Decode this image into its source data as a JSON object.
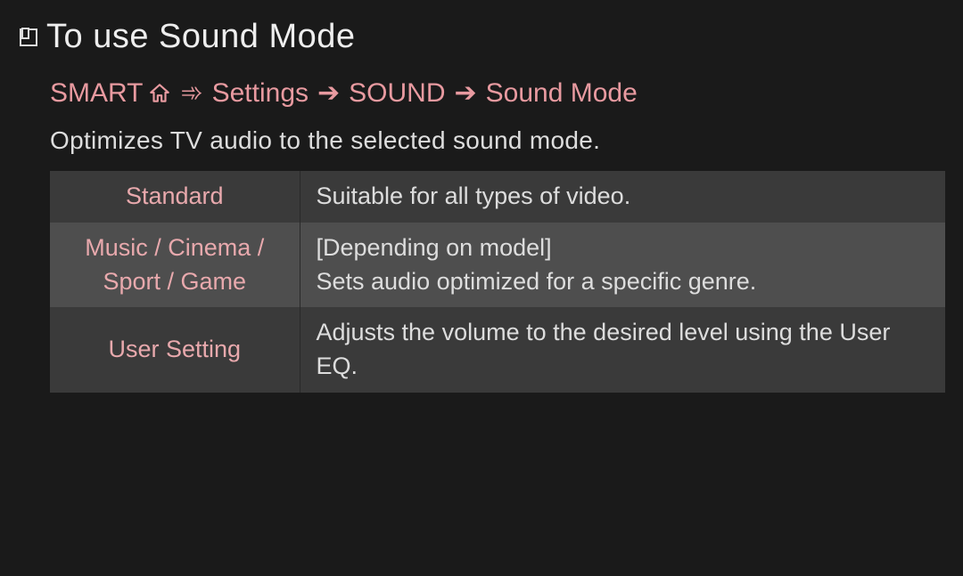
{
  "title": "To use Sound Mode",
  "breadcrumb": {
    "smart": "SMART",
    "settings": "Settings",
    "sound": "SOUND",
    "sound_mode": "Sound Mode"
  },
  "description": "Optimizes TV audio to the selected sound mode.",
  "table": {
    "rows": [
      {
        "name": "Standard",
        "desc": "Suitable for all types of video."
      },
      {
        "name": "Music / Cinema / Sport / Game",
        "desc": "[Depending on model]\nSets audio optimized for a specific genre."
      },
      {
        "name": "User Setting",
        "desc": "Adjusts the volume to the desired level using the User EQ."
      }
    ]
  }
}
